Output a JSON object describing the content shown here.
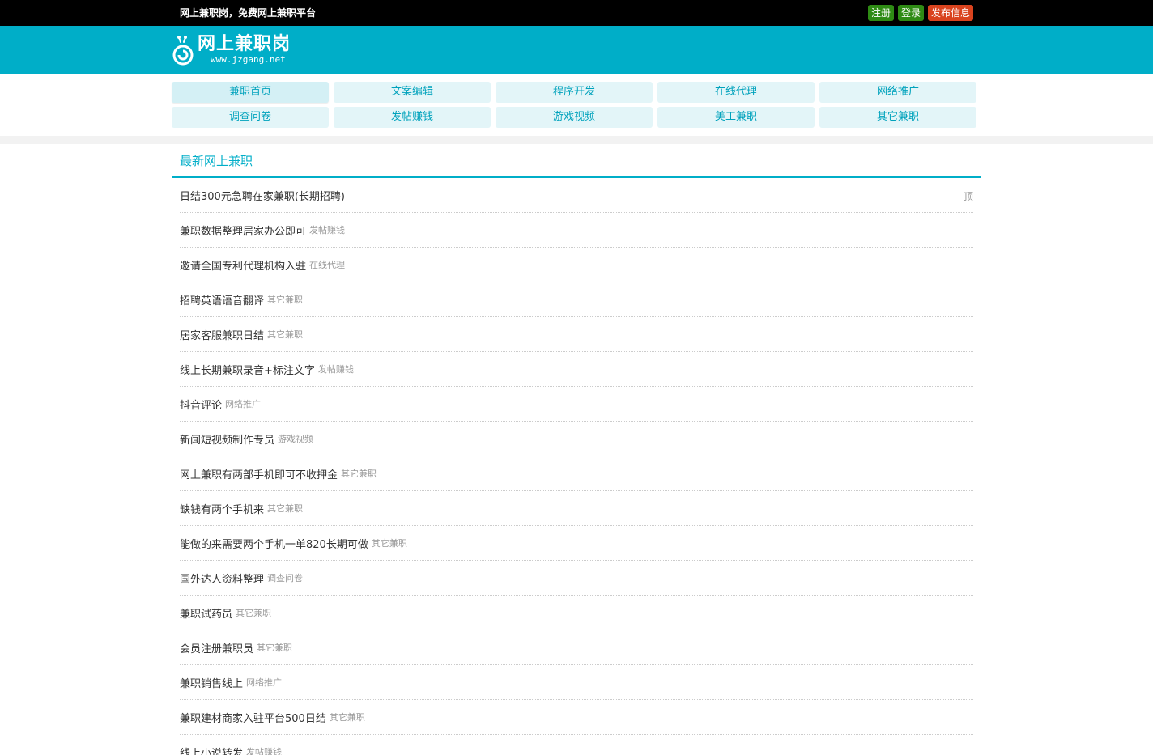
{
  "topbar": {
    "slogan": "网上兼职岗，免费网上兼职平台",
    "register": "注册",
    "login": "登录",
    "publish": "发布信息"
  },
  "header": {
    "logo_text": "网上兼职岗",
    "logo_url": "www.jzgang.net"
  },
  "nav": {
    "row1": [
      "兼职首页",
      "文案编辑",
      "程序开发",
      "在线代理",
      "网络推广"
    ],
    "row2": [
      "调查问卷",
      "发帖赚钱",
      "游戏视频",
      "美工兼职",
      "其它兼职"
    ]
  },
  "section": {
    "title": "最新网上兼职"
  },
  "items": [
    {
      "title": "日结300元急聘在家兼职(长期招聘)",
      "category": "",
      "badge": "顶"
    },
    {
      "title": "兼职数据整理居家办公即可",
      "category": "发帖赚钱",
      "badge": ""
    },
    {
      "title": "邀请全国专利代理机构入驻",
      "category": "在线代理",
      "badge": ""
    },
    {
      "title": "招聘英语语音翻译",
      "category": "其它兼职",
      "badge": ""
    },
    {
      "title": "居家客服兼职日结",
      "category": "其它兼职",
      "badge": ""
    },
    {
      "title": "线上长期兼职录音+标注文字",
      "category": "发帖赚钱",
      "badge": ""
    },
    {
      "title": "抖音评论",
      "category": "网络推广",
      "badge": ""
    },
    {
      "title": "新闻短视频制作专员",
      "category": "游戏视频",
      "badge": ""
    },
    {
      "title": "网上兼职有两部手机即可不收押金",
      "category": "其它兼职",
      "badge": ""
    },
    {
      "title": "缺钱有两个手机来",
      "category": "其它兼职",
      "badge": ""
    },
    {
      "title": "能做的来需要两个手机一单820长期可做",
      "category": "其它兼职",
      "badge": ""
    },
    {
      "title": "国外达人资料整理",
      "category": "调查问卷",
      "badge": ""
    },
    {
      "title": "兼职试药员",
      "category": "其它兼职",
      "badge": ""
    },
    {
      "title": "会员注册兼职员",
      "category": "其它兼职",
      "badge": ""
    },
    {
      "title": "兼职销售线上",
      "category": "网络推广",
      "badge": ""
    },
    {
      "title": "兼职建材商家入驻平台500日结",
      "category": "其它兼职",
      "badge": ""
    },
    {
      "title": "线上小说转发",
      "category": "发帖赚钱",
      "badge": ""
    }
  ],
  "colors": {
    "accent": "#00aec8",
    "topbar": "#000000",
    "nav_bg": "#e3f5f8",
    "btn_green": "#2e8b14",
    "btn_red": "#d9431e"
  },
  "icons": {
    "logo": "snail-logo-icon"
  }
}
